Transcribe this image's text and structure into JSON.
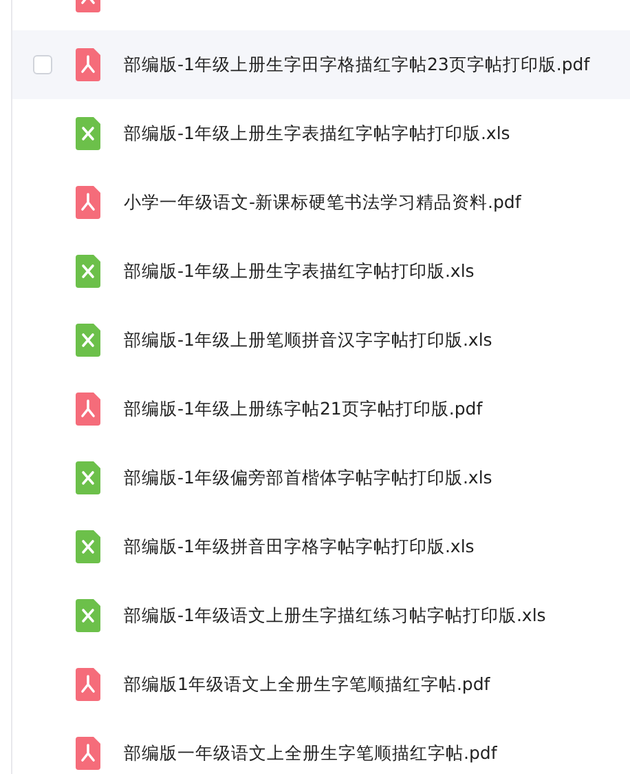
{
  "files": [
    {
      "kind": "pdf",
      "highlighted": false
    },
    {
      "kind": "pdf",
      "name": "部编版-1年级上册生字田字格描红字帖23页字帖打印版.pdf",
      "highlighted": true,
      "checked": false
    },
    {
      "kind": "xls",
      "name": "部编版-1年级上册生字表描红字帖字帖打印版.xls",
      "highlighted": false
    },
    {
      "kind": "pdf",
      "name": "小学一年级语文-新课标硬笔书法学习精品资料.pdf",
      "highlighted": false
    },
    {
      "kind": "xls",
      "name": "部编版-1年级上册生字表描红字帖打印版.xls",
      "highlighted": false
    },
    {
      "kind": "xls",
      "name": "部编版-1年级上册笔顺拼音汉字字帖打印版.xls",
      "highlighted": false
    },
    {
      "kind": "pdf",
      "name": "部编版-1年级上册练字帖21页字帖打印版.pdf",
      "highlighted": false
    },
    {
      "kind": "xls",
      "name": "部编版-1年级偏旁部首楷体字帖字帖打印版.xls",
      "highlighted": false
    },
    {
      "kind": "xls",
      "name": "部编版-1年级拼音田字格字帖字帖打印版.xls",
      "highlighted": false
    },
    {
      "kind": "xls",
      "name": "部编版-1年级语文上册生字描红练习帖字帖打印版.xls",
      "highlighted": false
    },
    {
      "kind": "pdf",
      "name": "部编版1年级语文上全册生字笔顺描红字帖.pdf",
      "highlighted": false
    },
    {
      "kind": "pdf",
      "name": "部编版一年级语文上全册生字笔顺描红字帖.pdf",
      "highlighted": false
    }
  ]
}
